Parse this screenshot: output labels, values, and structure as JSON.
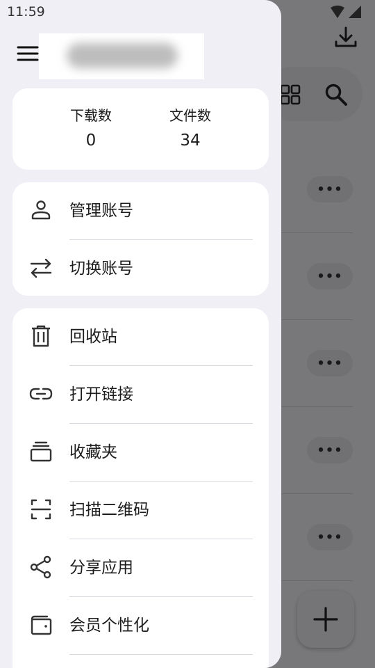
{
  "status_bar": {
    "time": "11:59"
  },
  "drawer": {
    "stats": [
      {
        "label": "下载数",
        "value": "0"
      },
      {
        "label": "文件数",
        "value": "34"
      }
    ],
    "account_items": [
      {
        "label": "管理账号",
        "icon": "person-icon"
      },
      {
        "label": "切换账号",
        "icon": "swap-icon"
      }
    ],
    "nav_items": [
      {
        "label": "回收站",
        "icon": "trash-icon"
      },
      {
        "label": "打开链接",
        "icon": "link-icon"
      },
      {
        "label": "收藏夹",
        "icon": "folder-stack-icon"
      },
      {
        "label": "扫描二维码",
        "icon": "scan-icon"
      },
      {
        "label": "分享应用",
        "icon": "share-icon"
      },
      {
        "label": "会员个性化",
        "icon": "wallet-icon"
      }
    ]
  },
  "background": {
    "more_label": "•••",
    "icons": [
      "download-icon",
      "grid-view-icon",
      "search-icon",
      "add-icon"
    ]
  },
  "colors": {
    "drawer_bg": "#f0eff5",
    "card_bg": "#ffffff",
    "text": "#1d1d1d",
    "scrim": "rgba(0,0,0,0.5)"
  }
}
